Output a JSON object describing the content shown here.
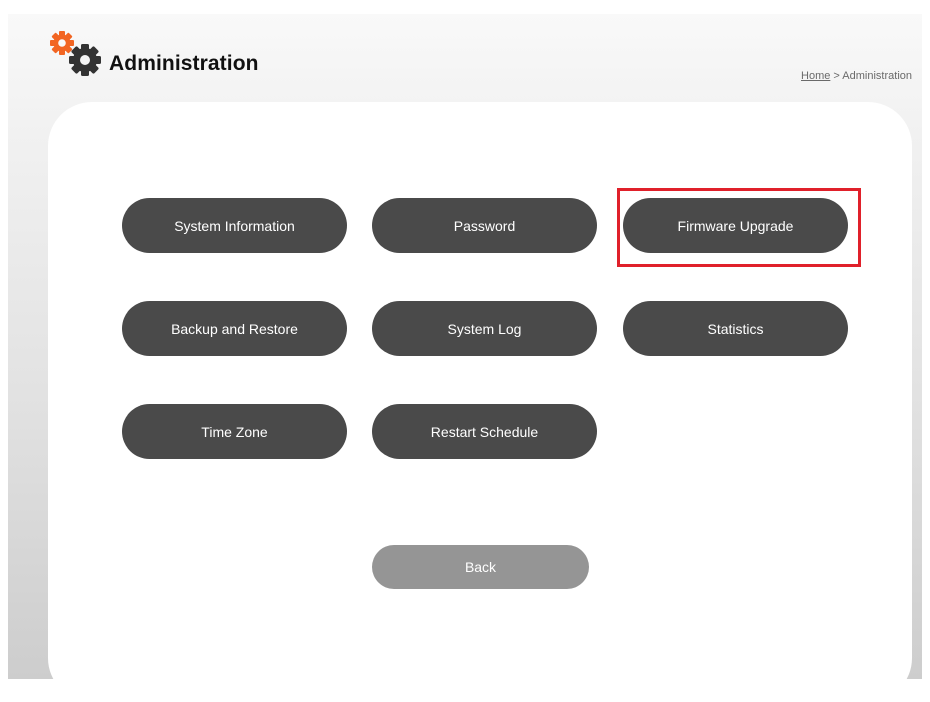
{
  "header": {
    "title": "Administration",
    "logo_icon": "gears-icon",
    "logo_colors": {
      "small_gear": "#f26522",
      "large_gear": "#333333"
    }
  },
  "breadcrumb": {
    "home": "Home",
    "separator": " > ",
    "current": "Administration"
  },
  "menu": {
    "buttons": [
      {
        "label": "System Information"
      },
      {
        "label": "Password"
      },
      {
        "label": "Firmware Upgrade",
        "highlighted": true
      },
      {
        "label": "Backup and Restore"
      },
      {
        "label": "System Log"
      },
      {
        "label": "Statistics"
      },
      {
        "label": "Time Zone"
      },
      {
        "label": "Restart Schedule"
      }
    ],
    "back_label": "Back"
  },
  "colors": {
    "button_bg": "#4a4a4a",
    "back_button_bg": "#959595",
    "highlight": "#e0202a"
  }
}
